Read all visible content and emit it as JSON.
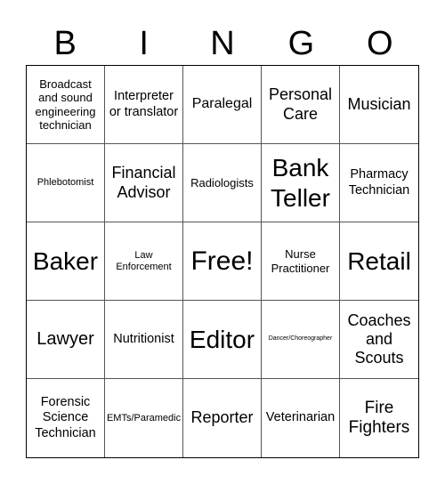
{
  "header": [
    "B",
    "I",
    "N",
    "G",
    "O"
  ],
  "cells": [
    "Broadcast and sound engineering technician",
    "Interpreter or translator",
    "Paralegal",
    "Personal Care",
    "Musician",
    "Phlebotomist",
    "Financial Advisor",
    "Radiologists",
    "Bank Teller",
    "Pharmacy Technician",
    "Baker",
    "Law Enforcement",
    "Free!",
    "Nurse Practitioner",
    "Retail",
    "Lawyer",
    "Nutritionist",
    "Editor",
    "Dancer/Choreographer",
    "Coaches and Scouts",
    "Forensic Science Technician",
    "EMTs/Paramedic",
    "Reporter",
    "Veterinarian",
    "Fire Fighters"
  ]
}
